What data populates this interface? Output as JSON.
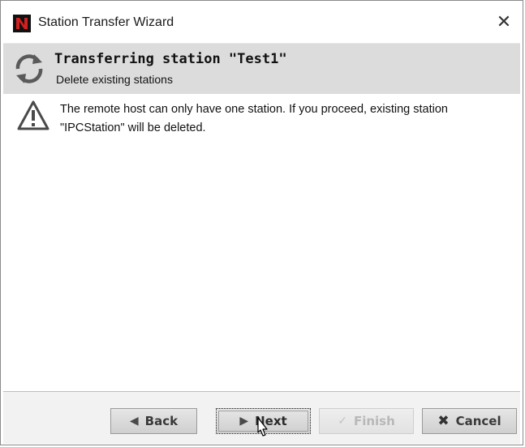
{
  "window": {
    "title": "Station Transfer Wizard",
    "close_glyph": "✕"
  },
  "header": {
    "title": "Transferring station \"Test1\"",
    "subtitle": "Delete existing stations",
    "icon": "sync-icon"
  },
  "content": {
    "icon": "warning-icon",
    "message": "The remote host can only have one station. If you proceed, existing station \"IPCStation\" will be deleted."
  },
  "buttons": {
    "back": {
      "label": "Back",
      "icon": "chevron-left-icon"
    },
    "next": {
      "label": "Next",
      "icon": "chevron-right-icon"
    },
    "finish": {
      "label": "Finish",
      "icon": "check-icon",
      "enabled": false
    },
    "cancel": {
      "label": "Cancel",
      "icon": "x-icon"
    }
  },
  "colors": {
    "header_bg": "#dcdcdc",
    "button_bar_bg": "#f2f2f2"
  }
}
